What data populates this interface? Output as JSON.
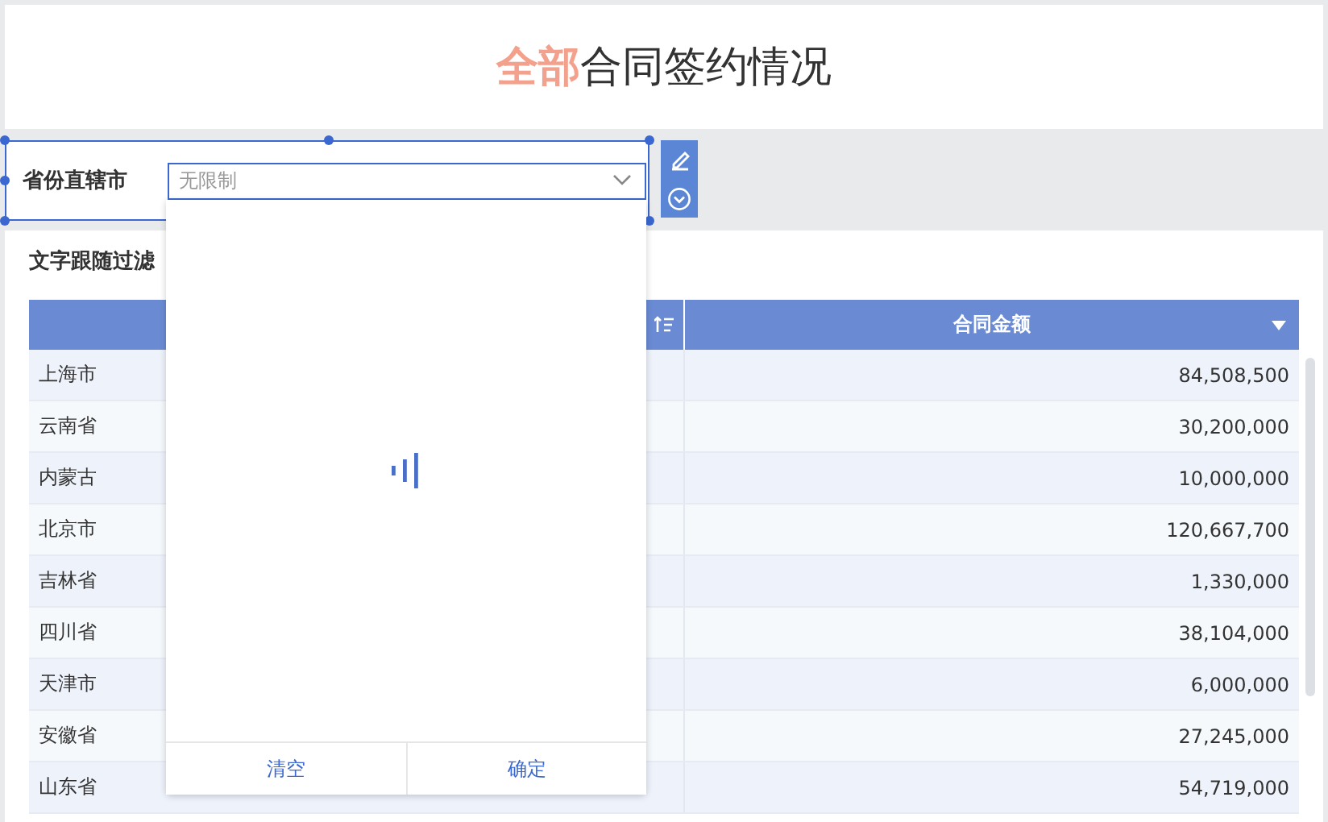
{
  "title": {
    "highlight": "全部",
    "rest": "合同签约情况"
  },
  "filter": {
    "label": "省份直辖市",
    "placeholder": "无限制",
    "open": true
  },
  "dropdown": {
    "loading": true,
    "buttons": [
      "清空",
      "确定"
    ]
  },
  "section": {
    "title": "文字跟随过滤"
  },
  "table": {
    "columns": [
      "",
      "合同金额"
    ],
    "rows": [
      {
        "cells": [
          "上海市",
          "84,508,500"
        ]
      },
      {
        "cells": [
          "云南省",
          "30,200,000"
        ]
      },
      {
        "cells": [
          "内蒙古",
          "10,000,000"
        ]
      },
      {
        "cells": [
          "北京市",
          "120,667,700"
        ]
      },
      {
        "cells": [
          "吉林省",
          "1,330,000"
        ]
      },
      {
        "cells": [
          "四川省",
          "38,104,000"
        ]
      },
      {
        "cells": [
          "天津市",
          "6,000,000"
        ]
      },
      {
        "cells": [
          "安徽省",
          "27,245,000"
        ]
      },
      {
        "cells": [
          "山东省",
          "54,719,000"
        ]
      }
    ]
  }
}
